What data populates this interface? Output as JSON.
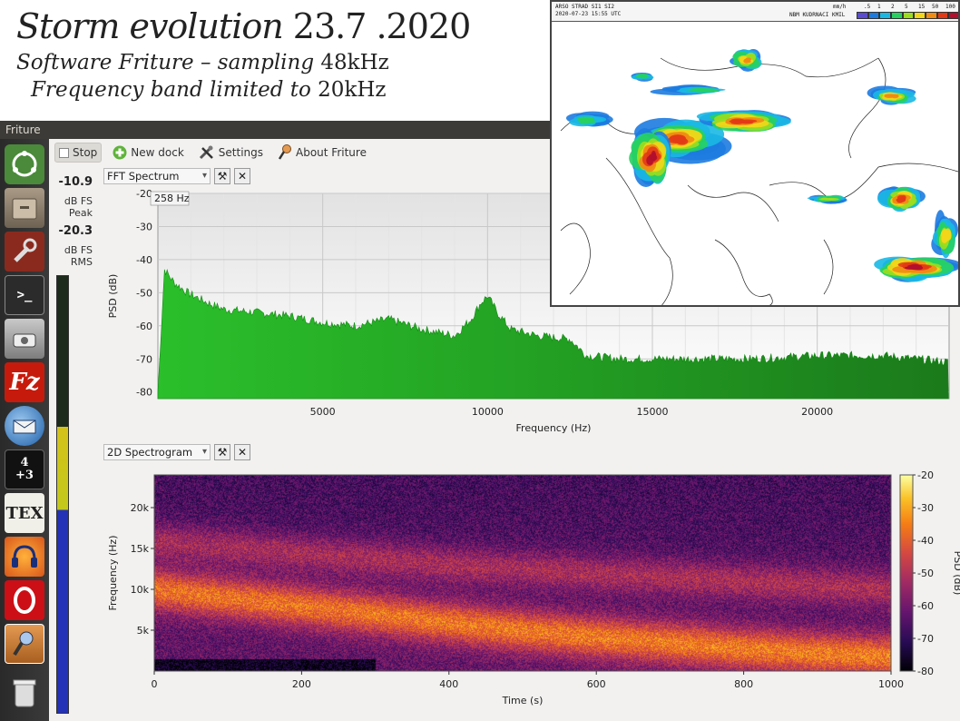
{
  "header": {
    "line1_text": "Storm evolution ",
    "line1_date": "23.7 .2020",
    "line2_text": "Software Friture – sampling ",
    "line2_value": "48kHz",
    "line3_text": "Frequency band limited to ",
    "line3_value": "20kHz"
  },
  "window": {
    "title": "Friture"
  },
  "toolbar": {
    "stop_label": "Stop",
    "new_dock_label": "New dock",
    "settings_label": "Settings",
    "about_label": "About Friture"
  },
  "levels": {
    "peak_value": "-10.9",
    "peak_unit": "dB FS",
    "peak_label": "Peak",
    "rms_value": "-20.3",
    "rms_unit": "dB FS",
    "rms_label": "RMS",
    "meter_colors": {
      "low": "#1c2b1c",
      "mid": "#d4c21a",
      "high": "#2432b8"
    }
  },
  "fft_dock": {
    "selector": "FFT Spectrum",
    "cursor_readout": "258 Hz"
  },
  "spectrogram_dock": {
    "selector": "2D Spectrogram"
  },
  "radar": {
    "header_left1": "ARSO STRAD SI1 SI2",
    "header_left2": "2020-07-23 15:55 UTC",
    "header_right_unit": "mm/h",
    "header_right_text": "NBM KUDRNACI KMIL",
    "scale_labels": [
      ".5",
      "1",
      "2",
      "5",
      "15",
      "50",
      "100"
    ],
    "scale_colors": [
      "#5a4bd1",
      "#1d7be0",
      "#19b8e3",
      "#27d061",
      "#9cdd1f",
      "#f2d61a",
      "#f08b14",
      "#e23a16",
      "#b20f2e"
    ]
  },
  "chart_data": [
    {
      "type": "area",
      "name": "fft-spectrum",
      "xlabel": "Frequency (Hz)",
      "ylabel": "PSD (dB)",
      "xlim": [
        0,
        24000
      ],
      "ylim": [
        -82,
        -20
      ],
      "xticks": [
        5000,
        10000,
        15000,
        20000
      ],
      "yticks": [
        -20,
        -30,
        -40,
        -50,
        -60,
        -70,
        -80
      ],
      "grid": true,
      "color": "#1a9a1a",
      "x": [
        0,
        200,
        500,
        900,
        1500,
        2000,
        3000,
        4000,
        5000,
        6000,
        7000,
        8000,
        9000,
        9500,
        9800,
        10000,
        10300,
        10700,
        11500,
        12500,
        13000,
        14000,
        15000,
        16000,
        18000,
        20000,
        22000,
        24000
      ],
      "y": [
        -80,
        -43,
        -47,
        -50,
        -53,
        -55,
        -56,
        -57,
        -59,
        -60,
        -58,
        -61,
        -63,
        -58,
        -53,
        -51,
        -56,
        -61,
        -63,
        -64,
        -69,
        -70,
        -70,
        -70,
        -70,
        -69,
        -69,
        -71
      ]
    },
    {
      "type": "heatmap",
      "name": "2d-spectrogram",
      "xlabel": "Time (s)",
      "ylabel": "Frequency (Hz)",
      "xlim": [
        0,
        1000
      ],
      "ylim": [
        0,
        24000
      ],
      "xticks": [
        0,
        200,
        400,
        600,
        800,
        1000
      ],
      "yticks": [
        5000,
        10000,
        15000,
        20000
      ],
      "ytick_labels": [
        "5k",
        "10k",
        "15k",
        "20k"
      ],
      "colorbar_label": "PSD (dB)",
      "colorbar_range": [
        -80,
        -20
      ],
      "colorbar_ticks": [
        -20,
        -30,
        -40,
        -50,
        -60,
        -70,
        -80
      ],
      "band_centers": {
        "time_s": [
          0,
          100,
          200,
          300,
          400,
          500,
          600,
          700,
          800,
          900,
          1000
        ],
        "main_band_hz": [
          10000,
          9000,
          8000,
          7000,
          6000,
          5000,
          4200,
          3500,
          2800,
          2200,
          1800
        ],
        "upper_band_hz": [
          16000,
          15200,
          14500,
          13800,
          13000,
          12500,
          12000,
          11500,
          11000,
          10500,
          10000
        ]
      }
    }
  ]
}
